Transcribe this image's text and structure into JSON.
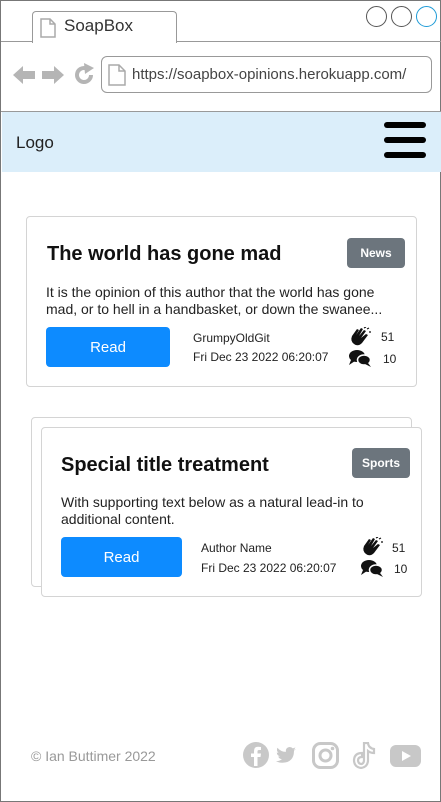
{
  "browser": {
    "tab_title": "SoapBox",
    "url": "https://soapbox-opinions.herokuapp.com/"
  },
  "header": {
    "logo": "Logo"
  },
  "posts": [
    {
      "title": "The world has gone mad",
      "category": "News",
      "excerpt": "It is the opinion of this author that the world has gone mad, or to hell in a handbasket, or down the swanee...",
      "read_label": "Read",
      "author": "GrumpyOldGit",
      "date": "Fri Dec 23 2022 06:20:07",
      "claps": "51",
      "comments": "10"
    },
    {
      "title": "Special title treatment",
      "category": "Sports",
      "excerpt": "With supporting text below as a natural lead-in to additional content.",
      "read_label": "Read",
      "author": "Author Name",
      "date": "Fri Dec 23 2022 06:20:07",
      "claps": "51",
      "comments": "10"
    }
  ],
  "footer": {
    "copyright": "© Ian Buttimer 2022",
    "social_icons": [
      "facebook-icon",
      "twitter-icon",
      "instagram-icon",
      "tiktok-icon",
      "youtube-icon"
    ]
  },
  "colors": {
    "header_bg": "#dbeefa",
    "button": "#0d8bff",
    "badge": "#6c757d",
    "footer_text": "#999999"
  }
}
